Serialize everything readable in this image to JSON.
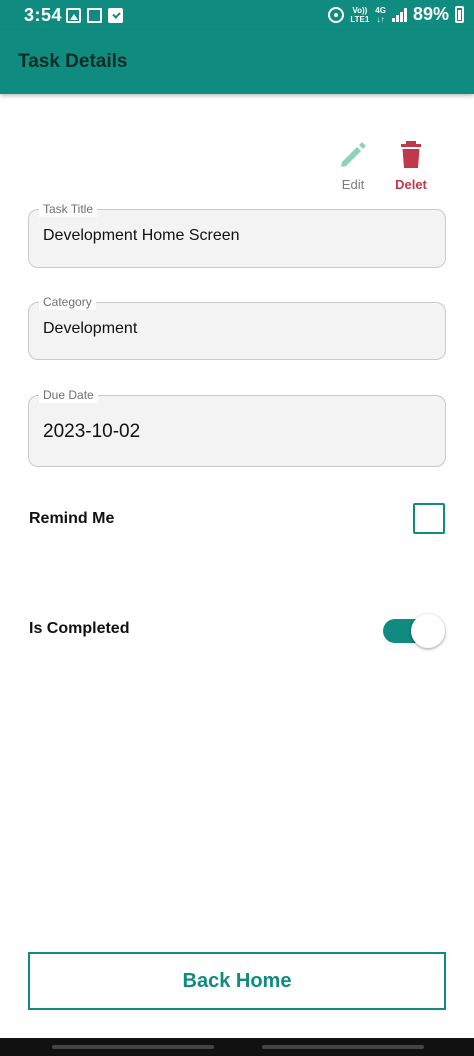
{
  "status_bar": {
    "time": "3:54",
    "volte_line1": "Vo))",
    "volte_line2": "LTE1",
    "network_line1": "4G",
    "network_line2": "↓↑",
    "battery": "89%"
  },
  "app_bar": {
    "title": "Task Details"
  },
  "actions": {
    "edit_label": "Edit",
    "delete_label": "Delet"
  },
  "fields": {
    "task_title": {
      "label": "Task Title",
      "value": "Development Home Screen"
    },
    "category": {
      "label": "Category",
      "value": "Development"
    },
    "due_date": {
      "label": "Due Date",
      "value": "2023-10-02"
    }
  },
  "remind_me": {
    "label": "Remind Me",
    "checked": false
  },
  "is_completed": {
    "label": "Is Completed",
    "on": true
  },
  "back_home": {
    "label": "Back Home"
  },
  "colors": {
    "primary": "#0f8c7f",
    "edit_icon": "#8fd3b5",
    "delete": "#c0394a"
  }
}
